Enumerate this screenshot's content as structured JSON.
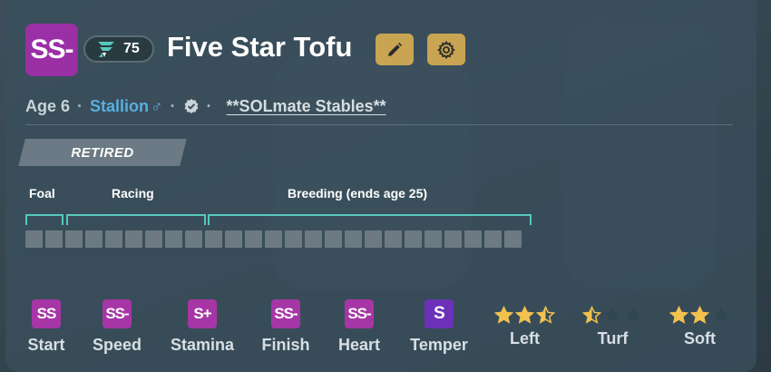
{
  "horse": {
    "grade": "SS-",
    "rating": "75",
    "name": "Five Star Tofu",
    "age": "Age 6",
    "sex": "Stallion",
    "sex_symbol": "♂",
    "stable": "**SOLmate Stables**",
    "status": "RETIRED"
  },
  "lifecycle": {
    "phases": [
      "Foal",
      "Racing",
      "Breeding (ends age 25)"
    ],
    "total_cells": 25,
    "filled_cells": 0
  },
  "stats": [
    {
      "grade": "SS",
      "label": "Start"
    },
    {
      "grade": "SS-",
      "label": "Speed"
    },
    {
      "grade": "S+",
      "label": "Stamina"
    },
    {
      "grade": "SS-",
      "label": "Finish"
    },
    {
      "grade": "SS-",
      "label": "Heart"
    },
    {
      "grade": "S",
      "label": "Temper"
    }
  ],
  "preferences": [
    {
      "label": "Left",
      "stars": 2.5,
      "max": 3
    },
    {
      "label": "Turf",
      "stars": 0.5,
      "max": 3
    },
    {
      "label": "Soft",
      "stars": 2,
      "max": 3
    }
  ],
  "icons": {
    "edit": "pencil-icon",
    "settings": "gear-icon",
    "verified": "verified-badge-icon",
    "rating": "class-rating-icon"
  },
  "colors": {
    "grade_ss": "#a636a6",
    "grade_s": "#6c31b8",
    "gold": "#c9a452",
    "teal": "#57c8bd",
    "star_on": "#f2c14e",
    "star_off": "#2f4750"
  }
}
